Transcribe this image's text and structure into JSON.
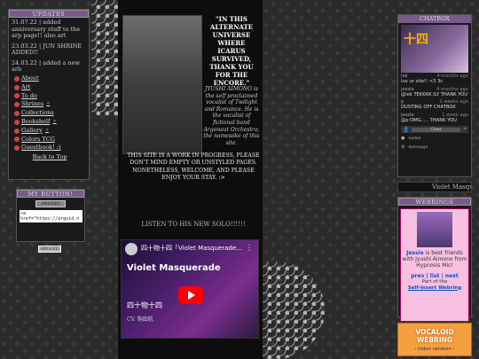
{
  "left": {
    "updates_title": "UPDATES",
    "updates": [
      "31.07.22 | added anniversary stuff to the arp page!! also art",
      "23.03.22 | JUN SHRINE ADDED!!",
      "24.03.22 | added a new arb"
    ],
    "nav": [
      {
        "label": "About",
        "spark": ""
      },
      {
        "label": "Art",
        "spark": ""
      },
      {
        "label": "To do",
        "spark": ""
      },
      {
        "label": "Shrines",
        "spark": "✧"
      },
      {
        "label": "Collections",
        "spark": ""
      },
      {
        "label": "Bookshelf",
        "spark": "✧"
      },
      {
        "label": "Gallery",
        "spark": "✧"
      },
      {
        "label": "Colors TCG",
        "spark": ""
      },
      {
        "label": "Guestbook! :)",
        "spark": ""
      }
    ],
    "back_to_top": "Back to Top",
    "my_button_title": "MY BUTTON!",
    "button_image_text": "ARGOID",
    "button_code": "<a href=\"https://argoid.n",
    "small_button_text": "ARGOID"
  },
  "center": {
    "intro": "\"IN THIS ALTERNATE UNIVERSE WHERE ICARUS SURVIVED, THANK YOU FOR THE ENCORE.\"",
    "bio": "JYUSHI AIMONO is the self proclaimed vocalist of Twilight and Romance. He is the vocalist of fictional band Argonaut Orchestra; the namesake of this site.",
    "notice": "THIS SITE IS A WORK IN PROGRESS, PLEASE DON'T MIND EMPTY OR UNSTYLED PAGES. NONETHELESS, WELCOME, AND PLEASE ENJOY YOUR STAY. :>",
    "listen": "LISTEN TO HIS NEW SOLO!!!!!!",
    "video_title": "四十物十四「Violet Masquerade…",
    "video_big": "Violet Masquerade",
    "video_jp": "四十物十四",
    "video_sub": "CV. 駒田航"
  },
  "right": {
    "chatbox_title": "CHATBOX",
    "chat_image_text": "十四",
    "messages": [
      {
        "name": "lok",
        "time": "4 months ago",
        "text": "luv ur site!! <3 3c"
      },
      {
        "name": "jessie",
        "time": "4 months ago",
        "text": "@lok TEKKKK ILY THANK YOU"
      },
      {
        "name": "p",
        "time": "2 weeks ago",
        "text": "DUSTING OFF CHATBOX"
      },
      {
        "name": "jessie",
        "time": "1 week ago",
        "text": "@p OMG..... THANK YOU"
      }
    ],
    "chat_row1": "Clear",
    "chat_name": "name",
    "chat_message": "message",
    "violet_text": "Violet Masquerade",
    "webrings_title": "WEBRINGS",
    "webring_text_1": "Jessie",
    "webring_text_2": "is best friends with Jyushi Aimono from Hypnosis Mic!",
    "webring_links": "prev | list | next",
    "webring_part1": "Part of the",
    "webring_part2": "Self-Insert Webring",
    "vocaloid_title": "VOCALOID WEBRING",
    "vocaloid_links": "‹ index  random ›"
  }
}
